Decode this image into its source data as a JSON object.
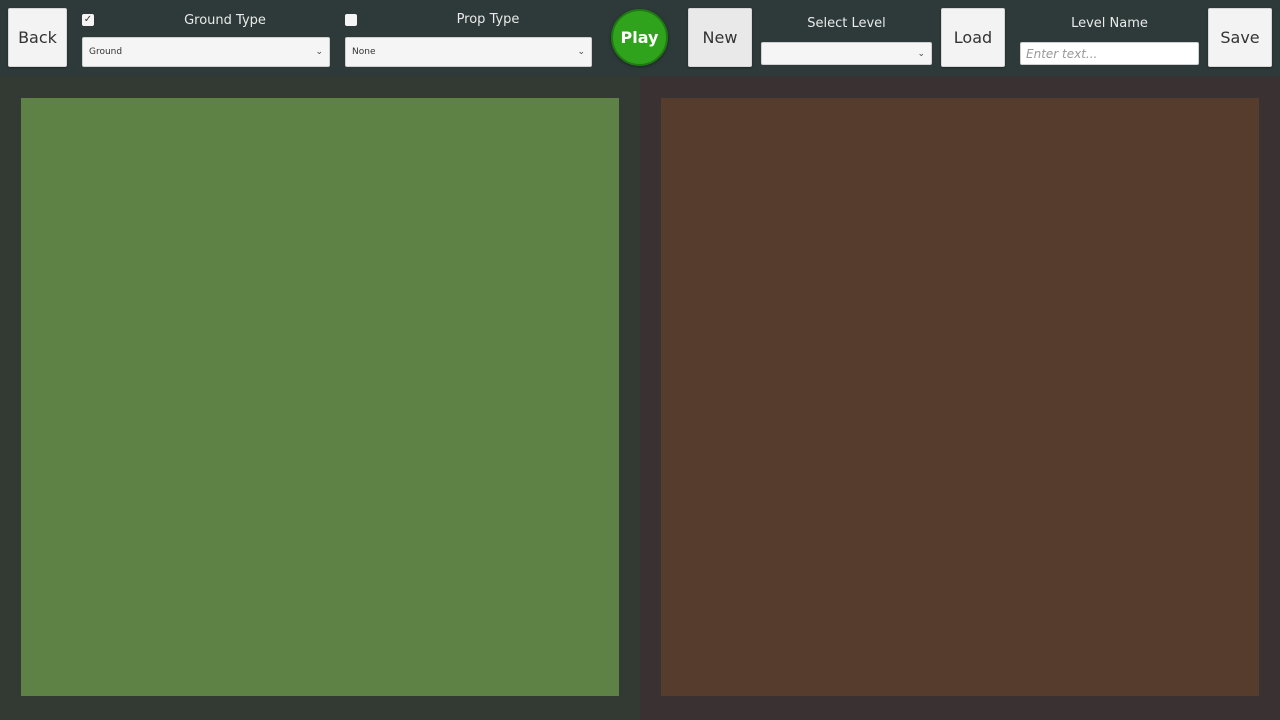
{
  "toolbar": {
    "back_label": "Back",
    "ground_type": {
      "label": "Ground Type",
      "checked": true,
      "selected": "Ground"
    },
    "prop_type": {
      "label": "Prop Type",
      "checked": false,
      "selected": "None"
    },
    "play_label": "Play",
    "new_label": "New",
    "select_level": {
      "label": "Select Level",
      "selected": ""
    },
    "load_label": "Load",
    "level_name": {
      "label": "Level Name",
      "placeholder": "Enter text..."
    },
    "save_label": "Save"
  },
  "colors": {
    "ground_tile": "#5e8145",
    "prop_tile": "#553c2d",
    "play_button": "#2fa31b",
    "toolbar_bg": "#2e3a3a"
  },
  "icons": {
    "check": "✓",
    "chevron": "⌄"
  }
}
